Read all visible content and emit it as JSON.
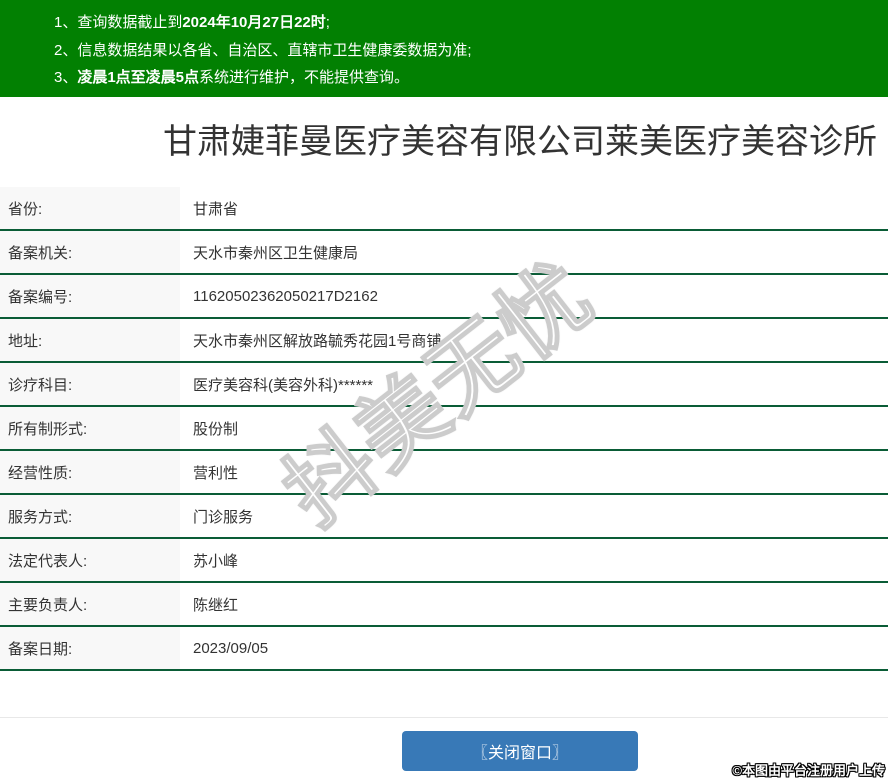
{
  "colors": {
    "notice_bar_bg": "#028002",
    "row_divider_green": "#0a5c36",
    "label_column_bg": "#f8f8f8",
    "close_button_blue": "#3879b7",
    "text_dark": "#333333"
  },
  "notices": {
    "items": [
      {
        "pre": "1、查询数据截止到",
        "bold": "2024年10月27日22时",
        "post": ";"
      },
      {
        "pre": "2、信息数据结果以各省、自治区、直辖市卫生健康委数据为准;",
        "bold": "",
        "post": ""
      },
      {
        "pre": "3、",
        "bold": "凌晨1点至凌晨5点",
        "post": "系统进行维护，不能提供查询。"
      }
    ]
  },
  "title": "甘肃婕菲曼医疗美容有限公司莱美医疗美容诊所",
  "table": {
    "rows": [
      {
        "label": "省份:",
        "value": "甘肃省"
      },
      {
        "label": "备案机关:",
        "value": "天水市秦州区卫生健康局"
      },
      {
        "label": "备案编号:",
        "value": "11620502362050217D2162"
      },
      {
        "label": "地址:",
        "value": "天水市秦州区解放路毓秀花园1号商铺"
      },
      {
        "label": "诊疗科目:",
        "value": "医疗美容科(美容外科)******"
      },
      {
        "label": "所有制形式:",
        "value": "股份制"
      },
      {
        "label": "经营性质:",
        "value": "营利性"
      },
      {
        "label": "服务方式:",
        "value": "门诊服务"
      },
      {
        "label": "法定代表人:",
        "value": "苏小峰"
      },
      {
        "label": "主要负责人:",
        "value": "陈继红"
      },
      {
        "label": "备案日期:",
        "value": "2023/09/05"
      }
    ]
  },
  "close_button": {
    "label": "〖关闭窗口〗"
  },
  "watermark": {
    "text": "抖美无忧"
  },
  "copyright": "©本图由平台注册用户上传"
}
